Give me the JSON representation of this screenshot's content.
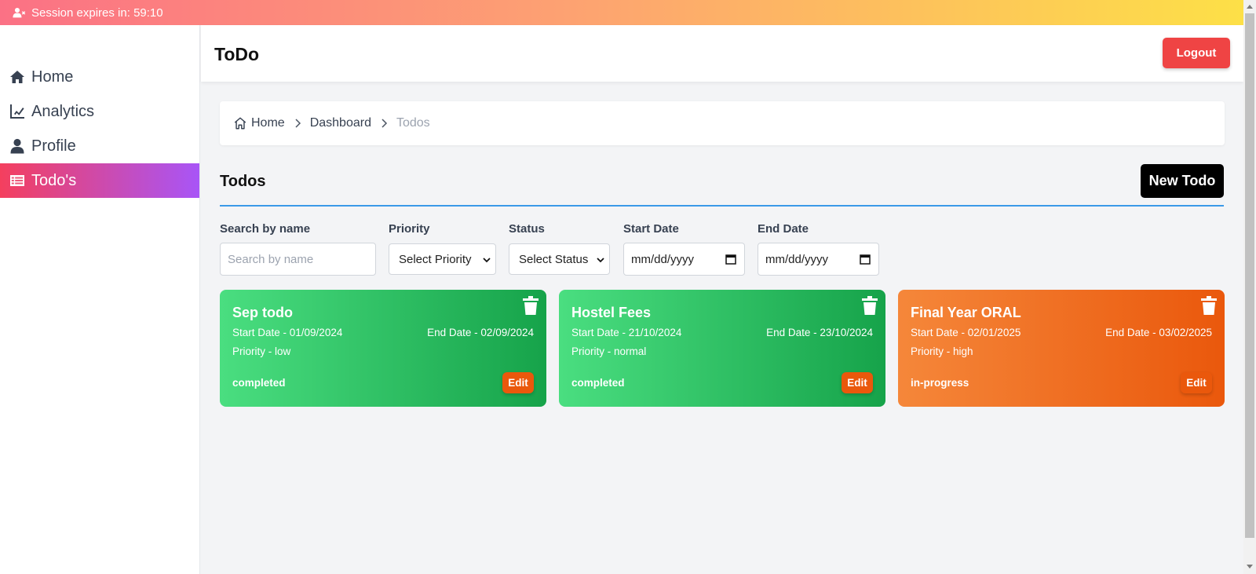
{
  "session": {
    "text": "Session expires in: 59:10",
    "icon": "user-clock-icon"
  },
  "sidebar": {
    "items": [
      {
        "label": "Home",
        "icon": "house-icon"
      },
      {
        "label": "Analytics",
        "icon": "chart-icon"
      },
      {
        "label": "Profile",
        "icon": "user-icon"
      },
      {
        "label": "Todo's",
        "icon": "list-icon",
        "active": true
      }
    ]
  },
  "header": {
    "title": "ToDo",
    "logout_label": "Logout"
  },
  "breadcrumb": {
    "items": [
      "Home",
      "Dashboard",
      "Todos"
    ]
  },
  "section": {
    "title": "Todos",
    "new_button": "New Todo"
  },
  "filters": {
    "search": {
      "label": "Search by name",
      "placeholder": "Search by name"
    },
    "priority": {
      "label": "Priority",
      "value": "Select Priority"
    },
    "status": {
      "label": "Status",
      "value": "Select Status"
    },
    "start_date": {
      "label": "Start Date",
      "value": "mm/dd/yyyy"
    },
    "end_date": {
      "label": "End Date",
      "value": "mm/dd/yyyy"
    }
  },
  "todos": [
    {
      "title": "Sep todo",
      "start": "Start Date - 01/09/2024",
      "end": "End Date - 02/09/2024",
      "priority": "Priority - low",
      "status": "completed",
      "edit": "Edit"
    },
    {
      "title": "Hostel Fees",
      "start": "Start Date - 21/10/2024",
      "end": "End Date - 23/10/2024",
      "priority": "Priority - normal",
      "status": "completed",
      "edit": "Edit"
    },
    {
      "title": "Final Year ORAL",
      "start": "Start Date - 02/01/2025",
      "end": "End Date - 03/02/2025",
      "priority": "Priority - high",
      "status": "in-progress",
      "edit": "Edit"
    }
  ],
  "colors": {
    "completed": "#22c55e",
    "in_progress": "#f97316",
    "logout": "#ef4444",
    "accent_line": "#3b9ae8"
  }
}
